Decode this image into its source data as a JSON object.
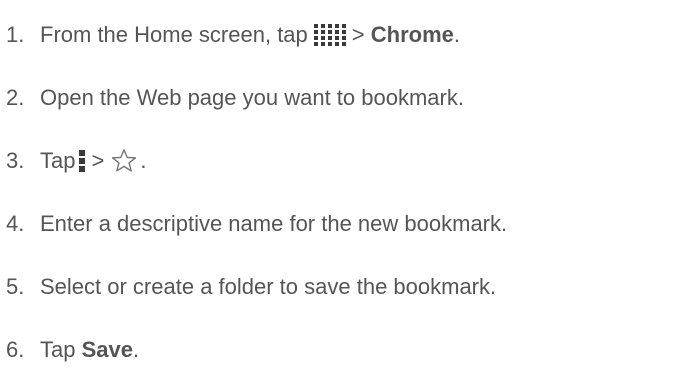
{
  "steps": [
    {
      "number": "1.",
      "text_before": "From the Home screen, tap",
      "text_middle": "> ",
      "bold": "Chrome",
      "text_after": "."
    },
    {
      "number": "2.",
      "text": "Open the Web page you want to bookmark."
    },
    {
      "number": "3.",
      "text_before": "Tap",
      "text_middle": ">",
      "text_after": "."
    },
    {
      "number": "4.",
      "text": "Enter a descriptive name for the new bookmark."
    },
    {
      "number": "5.",
      "text": "Select or create a folder to save the bookmark."
    },
    {
      "number": "6.",
      "text_before": "Tap ",
      "bold": "Save",
      "text_after": "."
    }
  ],
  "icons": {
    "apps": "apps-grid-icon",
    "menu": "menu-icon",
    "bookmark_star": "star-outline-icon"
  },
  "colors": {
    "text": "#555555",
    "icon": "#3a3a3a"
  }
}
